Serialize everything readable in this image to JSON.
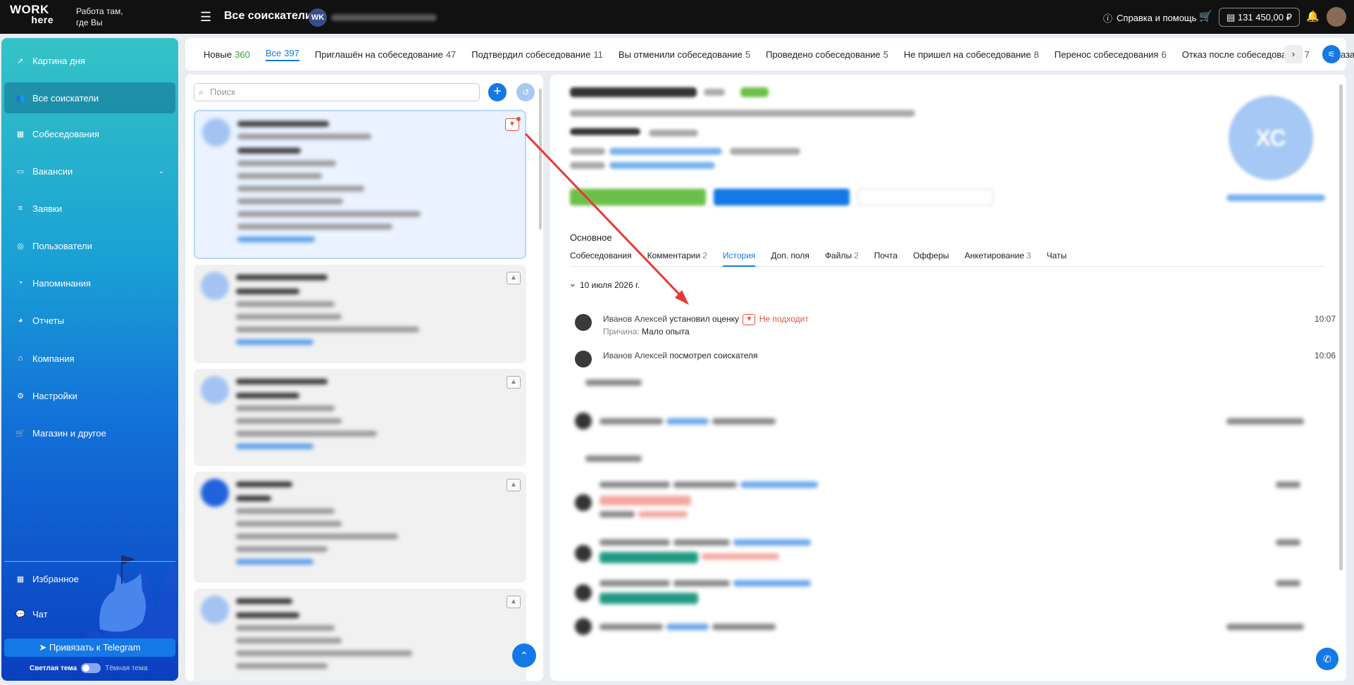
{
  "header": {
    "logo_line1": "WORK",
    "logo_line2": "here",
    "tagline_line1": "Работа там,",
    "tagline_line2": "где Вы",
    "page_title": "Все соискатели",
    "company_initials": "WK",
    "help_label": "Справка и помощь",
    "balance": "131 450,00 ₽"
  },
  "sidebar": {
    "items": [
      {
        "label": "Картина дня",
        "icon": "rocket-icon"
      },
      {
        "label": "Все соискатели",
        "icon": "users-icon"
      },
      {
        "label": "Собеседования",
        "icon": "calendar-icon"
      },
      {
        "label": "Вакансии",
        "icon": "briefcase-icon"
      },
      {
        "label": "Заявки",
        "icon": "list-icon"
      },
      {
        "label": "Пользователи",
        "icon": "user-icon"
      },
      {
        "label": "Напоминания",
        "icon": "bell-icon"
      },
      {
        "label": "Отчеты",
        "icon": "chart-icon"
      },
      {
        "label": "Компания",
        "icon": "home-icon"
      },
      {
        "label": "Настройки",
        "icon": "gear-icon"
      },
      {
        "label": "Магазин и другое",
        "icon": "cart-icon"
      },
      {
        "label": "Избранное",
        "icon": "grid-icon"
      },
      {
        "label": "Чат",
        "icon": "chat-icon"
      }
    ],
    "telegram_label": "Привязать к Telegram",
    "theme_light": "Светлая тема",
    "theme_dark": "Тёмная тема"
  },
  "status_tabs": [
    {
      "label": "Новые",
      "count": "360"
    },
    {
      "label": "Все",
      "count": "397"
    },
    {
      "label": "Приглашён на собеседование",
      "count": "47"
    },
    {
      "label": "Подтвердил собеседование",
      "count": "11"
    },
    {
      "label": "Вы отменили собеседование",
      "count": "5"
    },
    {
      "label": "Проведено собеседование",
      "count": "5"
    },
    {
      "label": "Не пришел на собеседование",
      "count": "8"
    },
    {
      "label": "Перенос собеседования",
      "count": "6"
    },
    {
      "label": "Отказ после собеседования",
      "count": "7"
    },
    {
      "label": "Отказа",
      "count": ""
    }
  ],
  "list": {
    "search_placeholder": "Поиск"
  },
  "detail": {
    "avatar_initials": "ХС",
    "section_title": "Основное",
    "tabs": [
      {
        "label": "Собеседования",
        "count": ""
      },
      {
        "label": "Комментарии",
        "count": "2"
      },
      {
        "label": "История",
        "count": ""
      },
      {
        "label": "Доп. поля",
        "count": ""
      },
      {
        "label": "Файлы",
        "count": "2"
      },
      {
        "label": "Почта",
        "count": ""
      },
      {
        "label": "Офферы",
        "count": ""
      },
      {
        "label": "Анкетирование",
        "count": "3"
      },
      {
        "label": "Чаты",
        "count": ""
      }
    ],
    "date_group": "10 июля 2026 г.",
    "events": [
      {
        "author": "Иванов Алексей",
        "action": "установил оценку",
        "rating": "Не подходит",
        "reason_label": "Причина:",
        "reason": "Мало опыта",
        "time": "10:07"
      },
      {
        "author": "Иванов Алексей",
        "action": "посмотрел соискателя",
        "time": "10:06"
      }
    ]
  },
  "colors": {
    "accent": "#1478e6",
    "negative": "#e1543a",
    "positive": "#3aa43a"
  }
}
